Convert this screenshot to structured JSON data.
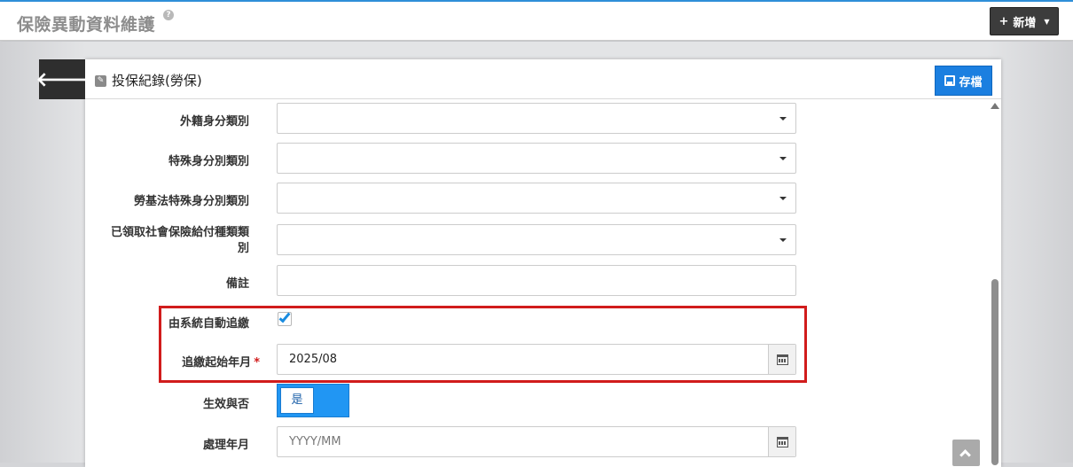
{
  "header": {
    "title": "保險異動資料維護",
    "help_icon": "question-circle-icon",
    "add_button": "新增",
    "add_icon": "plus-icon",
    "add_dropdown_icon": "caret-down-icon"
  },
  "card": {
    "back_icon": "arrow-left-icon",
    "edit_icon": "edit-icon",
    "title": "投保紀錄(勞保)",
    "save_label": "存檔",
    "save_icon": "floppy-disk-icon"
  },
  "form": {
    "foreign_identity": {
      "label": "外籍身分類別",
      "value": ""
    },
    "special_identity": {
      "label": "特殊身分別類別",
      "value": ""
    },
    "labor_law_special_identity": {
      "label": "勞基法特殊身分別類別",
      "value": ""
    },
    "social_insurance_benefit": {
      "label_line1": "已領取社會保險給付種類類",
      "label_line2": "別",
      "value": ""
    },
    "remarks": {
      "label": "備註",
      "value": ""
    },
    "auto_recover": {
      "label": "由系統自動追繳",
      "checked": true
    },
    "recover_start": {
      "label": "追繳起始年月",
      "required_mark": "*",
      "value": "2025/08"
    },
    "effective": {
      "label": "生效與否",
      "value": "是"
    },
    "process_month": {
      "label": "處理年月",
      "value": "",
      "placeholder": "YYYY/MM"
    }
  },
  "colors": {
    "accent": "#1b7fe0",
    "highlight_border": "#d11c1c",
    "toggle_on": "#2196f3",
    "header_button": "#3c3c3c"
  }
}
